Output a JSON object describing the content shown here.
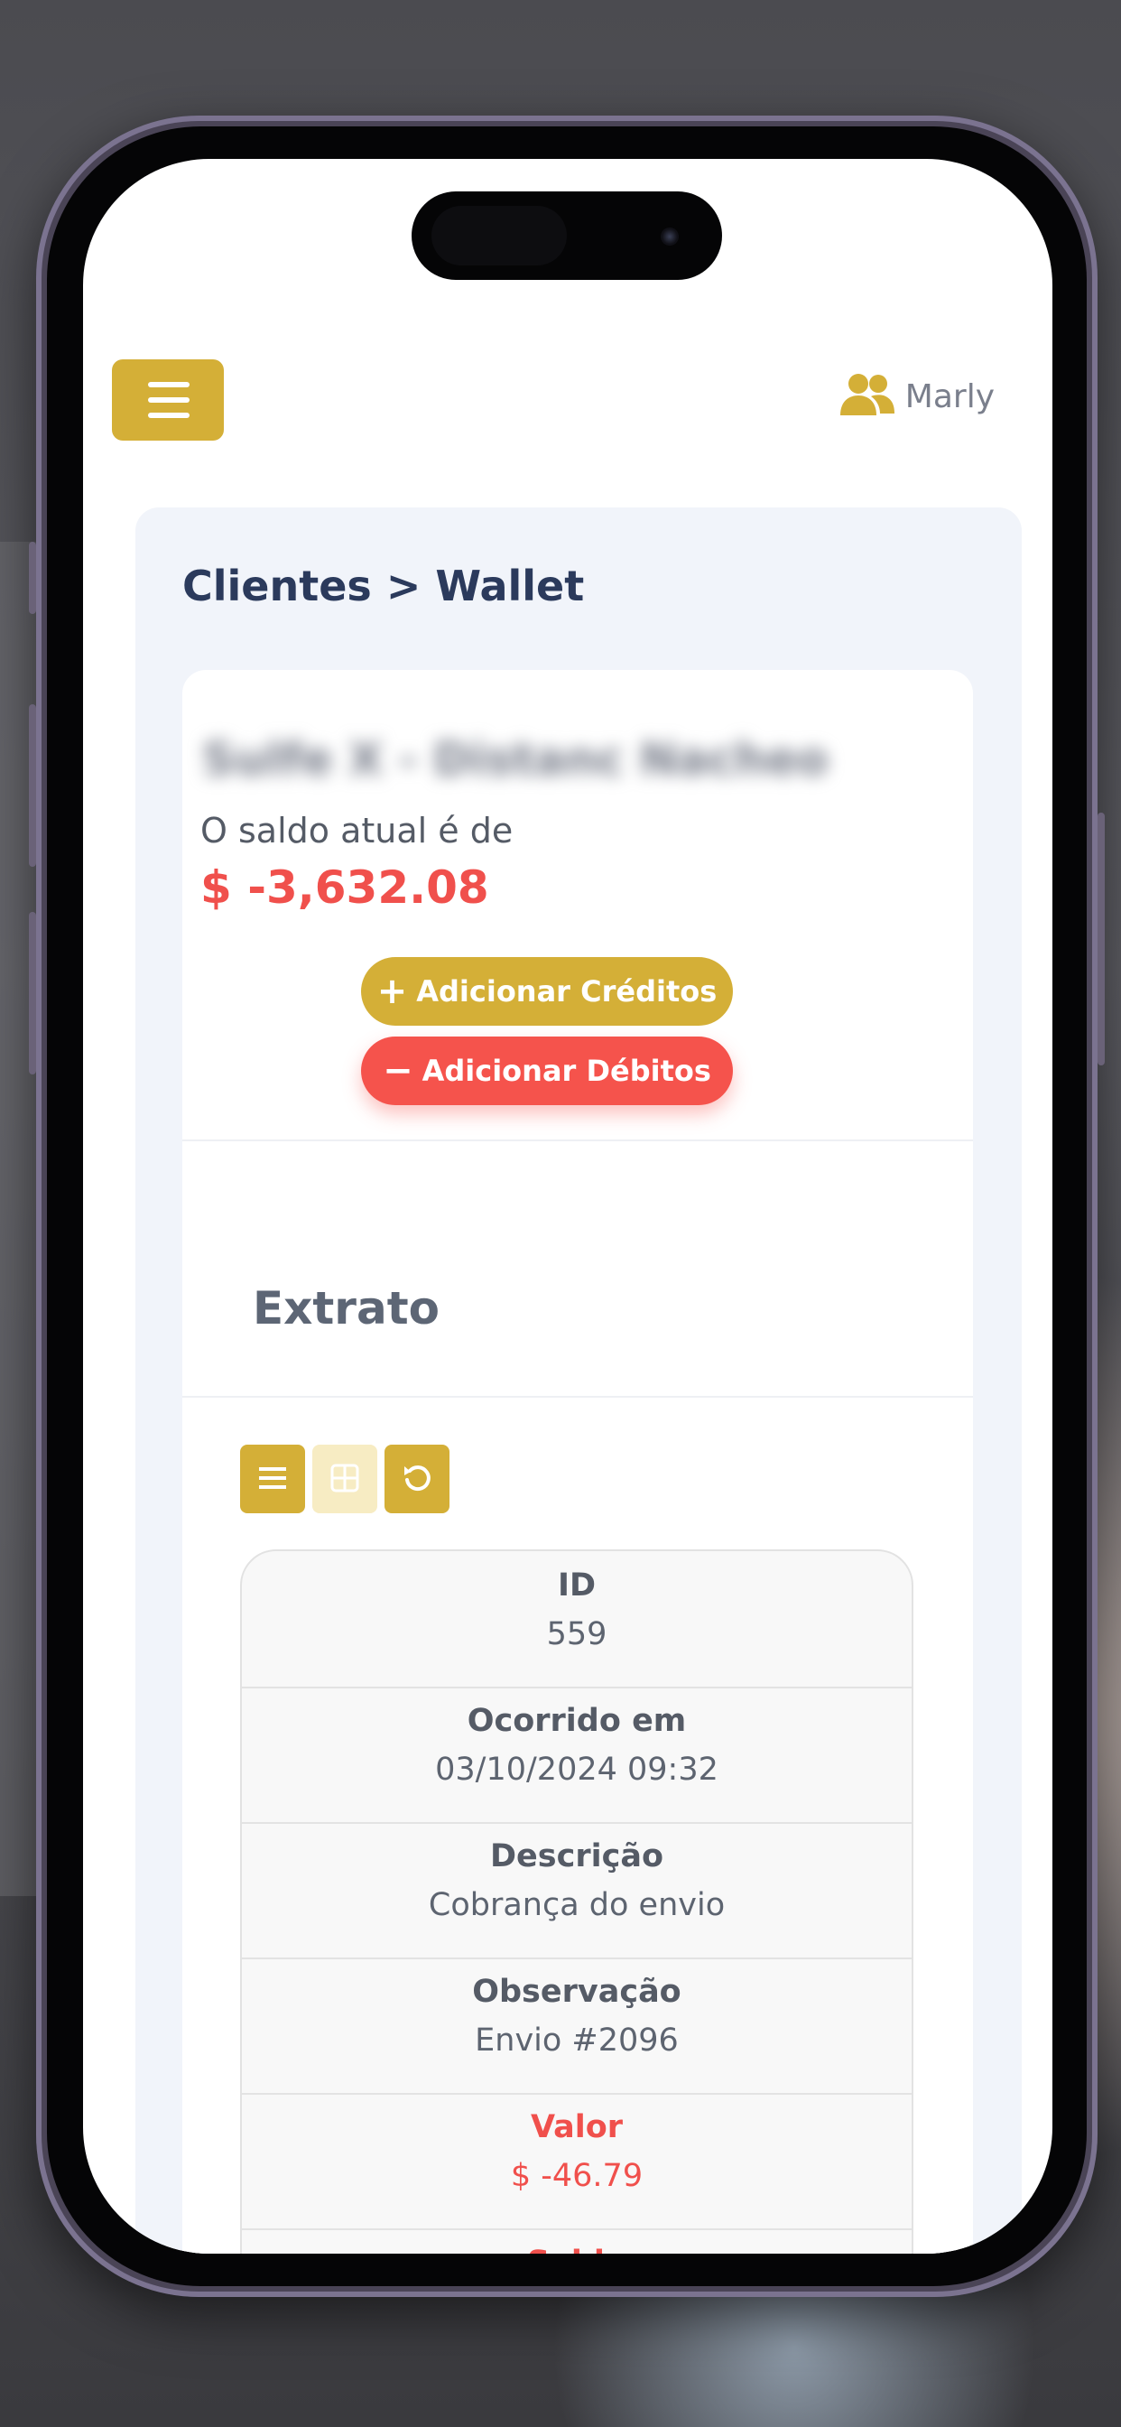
{
  "header": {
    "menu_icon": "hamburger-icon",
    "user_icon": "users-icon",
    "user_name": "Marly"
  },
  "breadcrumb": "Clientes > Wallet",
  "client": {
    "name": "Sulfe X - Distanc Nacheo",
    "balance_label": "O saldo atual é de",
    "balance_value": "$ -3,632.08"
  },
  "actions": {
    "add_credit_label": "Adicionar Créditos",
    "add_debit_label": "Adicionar Débitos"
  },
  "statement": {
    "title": "Extrato",
    "toolbar": [
      "list-view-icon",
      "grid-view-icon",
      "refresh-icon"
    ],
    "fields": [
      {
        "label": "ID",
        "value": "559"
      },
      {
        "label": "Ocorrido em",
        "value": "03/10/2024 09:32"
      },
      {
        "label": "Descrição",
        "value": "Cobrança do envio"
      },
      {
        "label": "Observação",
        "value": "Envio #2096"
      },
      {
        "label": "Valor",
        "value": "$ -46.79"
      },
      {
        "label": "Saldo",
        "value": ""
      }
    ]
  },
  "colors": {
    "accent": "#d4af37",
    "danger": "#f0504c",
    "breadcrumb": "#2b3a5c"
  }
}
